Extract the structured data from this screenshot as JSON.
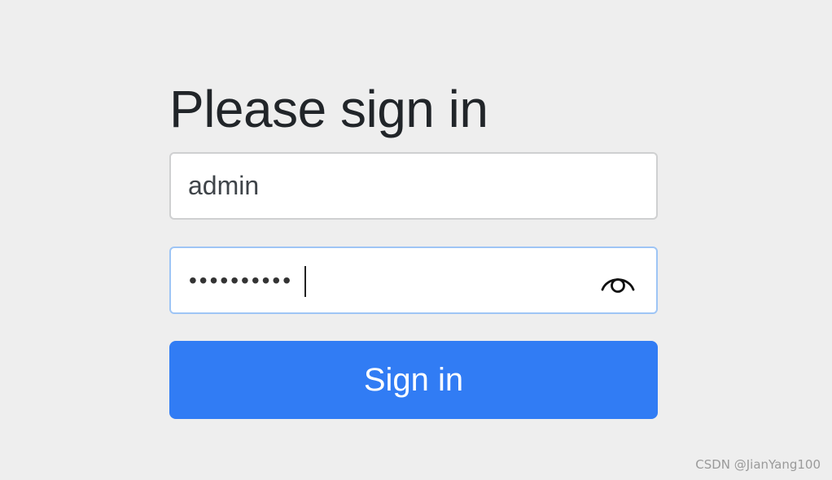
{
  "form": {
    "heading": "Please sign in",
    "username_value": "admin",
    "password_masked": "••••••••••",
    "password_length": 10,
    "submit_label": "Sign in",
    "show_password_icon": "eye-icon"
  },
  "watermark": "CSDN @JianYang100",
  "colors": {
    "background": "#eeeeee",
    "primary": "#317cf4",
    "focus_border": "#9ec5f5",
    "heading_text": "#212529"
  }
}
